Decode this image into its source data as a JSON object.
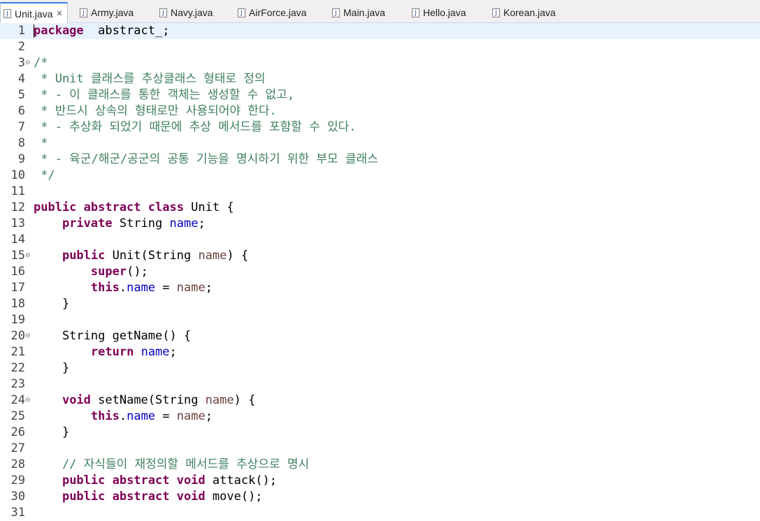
{
  "tabs": [
    {
      "label": "Unit.java",
      "active": true
    },
    {
      "label": "Army.java"
    },
    {
      "label": "Navy.java"
    },
    {
      "label": "AirForce.java"
    },
    {
      "label": "Main.java"
    },
    {
      "label": "Hello.java"
    },
    {
      "label": "Korean.java"
    }
  ],
  "icons": {
    "java_file": "java-file-icon",
    "close": "close-icon",
    "fold": "fold-collapse-icon"
  },
  "colors": {
    "keyword": "#7f0055",
    "field": "#0000c0",
    "parameter": "#6a3e3e",
    "comment": "#3f7f5f",
    "current_line": "#e8f2fe"
  },
  "lines": [
    {
      "n": "1",
      "t": [
        [
          "kw",
          "package"
        ],
        [
          "",
          "  abstract_;"
        ]
      ]
    },
    {
      "n": "2",
      "t": []
    },
    {
      "n": "3",
      "t": [
        [
          "cm",
          "/*"
        ]
      ]
    },
    {
      "n": "4",
      "t": [
        [
          "cm",
          " * Unit 클래스를 추상클래스 형태로 정의"
        ]
      ]
    },
    {
      "n": "5",
      "t": [
        [
          "cm",
          " * - 이 클래스를 통한 객체는 생성할 수 없고,"
        ]
      ]
    },
    {
      "n": "6",
      "t": [
        [
          "cm",
          " * 반드시 상속의 형태로만 사용되어야 한다."
        ]
      ]
    },
    {
      "n": "7",
      "t": [
        [
          "cm",
          " * - 추상화 되었기 때문에 추상 메서드를 포함할 수 있다."
        ]
      ]
    },
    {
      "n": "8",
      "t": [
        [
          "cm",
          " *"
        ]
      ]
    },
    {
      "n": "9",
      "t": [
        [
          "cm",
          " * - 육군/해군/공군의 공통 기능을 명시하기 위한 부모 클래스"
        ]
      ]
    },
    {
      "n": "10",
      "t": [
        [
          "cm",
          " */"
        ]
      ]
    },
    {
      "n": "11",
      "t": []
    },
    {
      "n": "12",
      "t": [
        [
          "kw",
          "public abstract class"
        ],
        [
          "",
          " Unit {"
        ]
      ]
    },
    {
      "n": "13",
      "t": [
        [
          "",
          "    "
        ],
        [
          "kw",
          "private"
        ],
        [
          "",
          " String "
        ],
        [
          "fld",
          "name"
        ],
        [
          "",
          ";"
        ]
      ]
    },
    {
      "n": "14",
      "t": []
    },
    {
      "n": "15",
      "t": [
        [
          "",
          "    "
        ],
        [
          "kw",
          "public"
        ],
        [
          "",
          " Unit(String "
        ],
        [
          "prm",
          "name"
        ],
        [
          "",
          ") {"
        ]
      ]
    },
    {
      "n": "16",
      "t": [
        [
          "",
          "        "
        ],
        [
          "kw",
          "super"
        ],
        [
          "",
          "();"
        ]
      ]
    },
    {
      "n": "17",
      "t": [
        [
          "",
          "        "
        ],
        [
          "kw",
          "this"
        ],
        [
          "",
          "."
        ],
        [
          "fld",
          "name"
        ],
        [
          "",
          " = "
        ],
        [
          "prm",
          "name"
        ],
        [
          "",
          ";"
        ]
      ]
    },
    {
      "n": "18",
      "t": [
        [
          "",
          "    }"
        ]
      ]
    },
    {
      "n": "19",
      "t": []
    },
    {
      "n": "20",
      "t": [
        [
          "",
          "    String getName() {"
        ]
      ]
    },
    {
      "n": "21",
      "t": [
        [
          "",
          "        "
        ],
        [
          "kw",
          "return"
        ],
        [
          "",
          " "
        ],
        [
          "fld",
          "name"
        ],
        [
          "",
          ";"
        ]
      ]
    },
    {
      "n": "22",
      "t": [
        [
          "",
          "    }"
        ]
      ]
    },
    {
      "n": "23",
      "t": []
    },
    {
      "n": "24",
      "t": [
        [
          "",
          "    "
        ],
        [
          "kw",
          "void"
        ],
        [
          "",
          " setName(String "
        ],
        [
          "prm",
          "name"
        ],
        [
          "",
          ") {"
        ]
      ]
    },
    {
      "n": "25",
      "t": [
        [
          "",
          "        "
        ],
        [
          "kw",
          "this"
        ],
        [
          "",
          "."
        ],
        [
          "fld",
          "name"
        ],
        [
          "",
          " = "
        ],
        [
          "prm",
          "name"
        ],
        [
          "",
          ";"
        ]
      ]
    },
    {
      "n": "26",
      "t": [
        [
          "",
          "    }"
        ]
      ]
    },
    {
      "n": "27",
      "t": []
    },
    {
      "n": "28",
      "t": [
        [
          "",
          "    "
        ],
        [
          "cm",
          "// 자식들이 재정의할 메서드를 추상으로 명시"
        ]
      ]
    },
    {
      "n": "29",
      "t": [
        [
          "",
          "    "
        ],
        [
          "kw",
          "public abstract void"
        ],
        [
          "",
          " attack();"
        ]
      ]
    },
    {
      "n": "30",
      "t": [
        [
          "",
          "    "
        ],
        [
          "kw",
          "public abstract void"
        ],
        [
          "",
          " move();"
        ]
      ]
    },
    {
      "n": "31",
      "t": []
    }
  ],
  "fold_lines": [
    "3",
    "15",
    "20",
    "24"
  ]
}
